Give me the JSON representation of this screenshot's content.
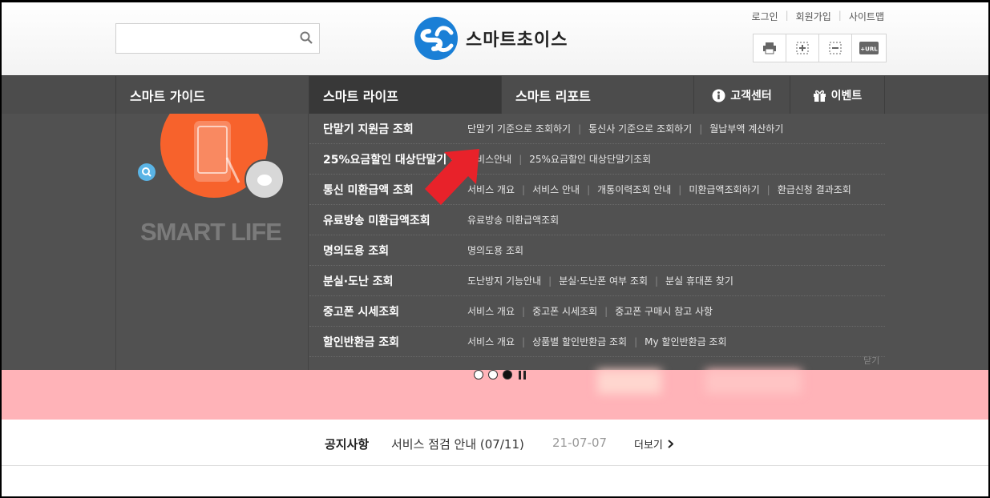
{
  "header": {
    "search": {
      "placeholder": "",
      "value": ""
    },
    "logo_text": "스마트초이스",
    "util_links": [
      "로그인",
      "회원가입",
      "사이트맵"
    ],
    "tools": [
      "print-icon",
      "zoom-in-icon",
      "zoom-out-icon",
      "url-copy-icon"
    ],
    "tool_url_text": "+URL"
  },
  "nav": {
    "items": [
      "스마트 가이드",
      "스마트 라이프",
      "스마트 리포트",
      "고객센터",
      "이벤트"
    ]
  },
  "mega": {
    "section_label": "SMART LIFE",
    "rows": [
      {
        "title": "단말기 지원금 조회",
        "links": [
          "단말기 기준으로 조회하기",
          "통신사 기준으로 조회하기",
          "월납부액 계산하기"
        ]
      },
      {
        "title": "25%요금할인 대상단말기 조회",
        "links": [
          "서비스안내",
          "25%요금할인 대상단말기조회"
        ]
      },
      {
        "title": "통신 미환급액 조회",
        "links": [
          "서비스 개요",
          "서비스 안내",
          "개통이력조회 안내",
          "미환급액조회하기",
          "환급신청 결과조회"
        ]
      },
      {
        "title": "유료방송 미환급액조회",
        "links": [
          "유료방송 미환급액조회"
        ]
      },
      {
        "title": "명의도용 조회",
        "links": [
          "명의도용 조회"
        ]
      },
      {
        "title": "분실·도난 조회",
        "links": [
          "도난방지 기능안내",
          "분실·도난폰 여부 조회",
          "분실 휴대폰 찾기"
        ]
      },
      {
        "title": "중고폰 시세조회",
        "links": [
          "서비스 개요",
          "중고폰 시세조회",
          "중고폰 구매시 참고 사항"
        ]
      },
      {
        "title": "할인반환금 조회",
        "links": [
          "서비스 개요",
          "상품별 할인반환금 조회",
          "My 할인반환금 조회"
        ]
      }
    ],
    "close_label": "닫기"
  },
  "notice": {
    "label": "공지사항",
    "text": "서비스 점검 안내 (07/11)",
    "date": "21-07-07",
    "more": "더보기"
  },
  "colors": {
    "nav_bg": "#4c4c4c",
    "menu_bg": "#515151",
    "accent_orange": "#f7622c",
    "banner_pink": "#ffb3b8",
    "logo_blue": "#1a7fd6",
    "arrow_red": "#e8222a"
  }
}
